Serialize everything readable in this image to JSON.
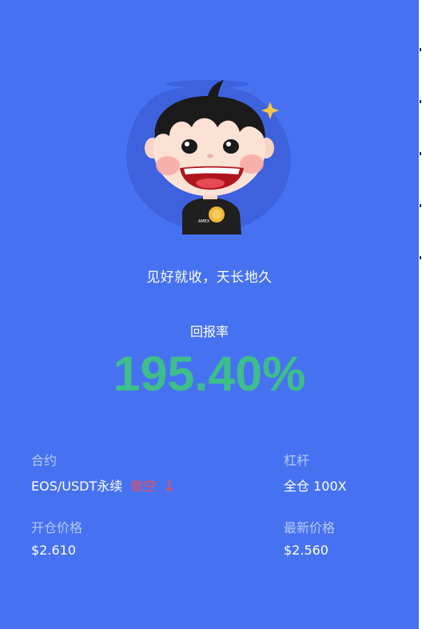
{
  "slogan": "见好就收，天长地久",
  "rate": {
    "label": "回报率",
    "value": "195.40%"
  },
  "contract": {
    "label": "合约",
    "value": "EOS/USDT永续",
    "direction": "做空",
    "direction_arrow": "↓"
  },
  "leverage": {
    "label": "杠杆",
    "value": "全仓 100X"
  },
  "open_price": {
    "label": "开仓价格",
    "value": "$2.610"
  },
  "latest_price": {
    "label": "最新价格",
    "value": "$2.560"
  },
  "mascot": {
    "shirt_logo": "AMEX"
  },
  "colors": {
    "background": "#4672F2",
    "rate_green": "#3DBE8A",
    "short_red": "#F04E52",
    "label_muted": "#B8C8F6"
  }
}
